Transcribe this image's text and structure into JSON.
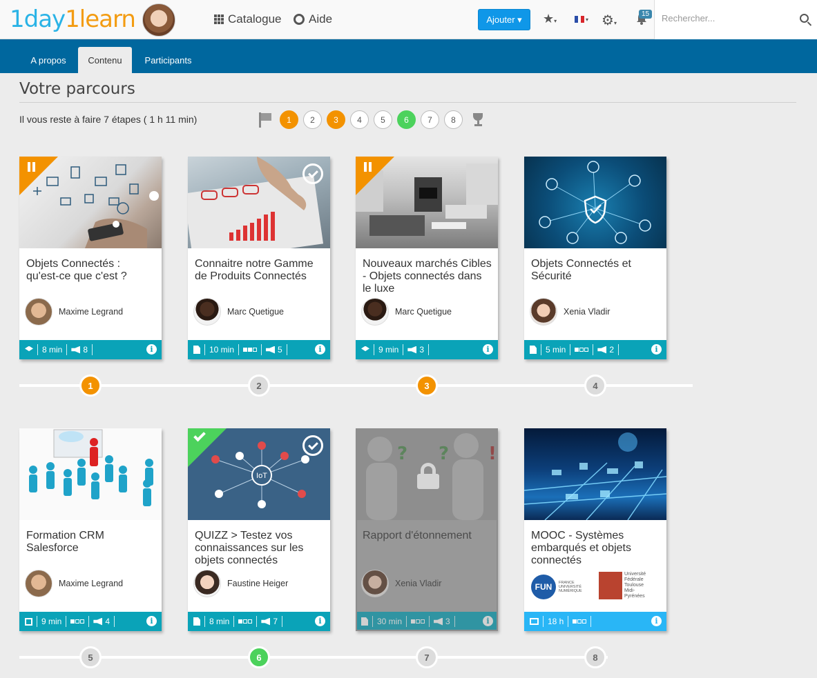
{
  "header": {
    "logo": {
      "part1": "1day",
      "part2": "1learn"
    },
    "nav": [
      {
        "label": "Catalogue",
        "icon": "grid-icon"
      },
      {
        "label": "Aide",
        "icon": "help-icon"
      }
    ],
    "add_button": "Ajouter ▾",
    "notifications_count": "15",
    "search_placeholder": "Rechercher..."
  },
  "tabs": [
    {
      "label": "A propos",
      "active": false
    },
    {
      "label": "Contenu",
      "active": true
    },
    {
      "label": "Participants",
      "active": false
    }
  ],
  "page": {
    "title": "Votre parcours",
    "remaining": "Il vous reste à faire 7 étapes ( 1 h 11 min)"
  },
  "steps": [
    {
      "label": "1",
      "state": "in-progress"
    },
    {
      "label": "2",
      "state": "todo"
    },
    {
      "label": "3",
      "state": "in-progress"
    },
    {
      "label": "4",
      "state": "todo"
    },
    {
      "label": "5",
      "state": "todo"
    },
    {
      "label": "6",
      "state": "done"
    },
    {
      "label": "7",
      "state": "todo"
    },
    {
      "label": "8",
      "state": "todo"
    }
  ],
  "cards": [
    {
      "title": "Objets Connectés : qu'est-ce que c'est ?",
      "author": "Maxime Legrand",
      "type_icon": "graduation-cap-icon",
      "duration": "8 min",
      "level": null,
      "rating": "8",
      "status": "in-progress",
      "badge": false,
      "step": "1"
    },
    {
      "title": "Connaitre notre Gamme de Produits Connectés",
      "author": "Marc Quetigue",
      "type_icon": "pdf-icon",
      "duration": "10 min",
      "level": 2,
      "rating": "5",
      "status": "todo",
      "badge": true,
      "step": "2"
    },
    {
      "title": "Nouveaux marchés Cibles - Objets connectés dans le luxe",
      "author": "Marc Quetigue",
      "type_icon": "graduation-cap-icon",
      "duration": "9 min",
      "level": null,
      "rating": "3",
      "status": "in-progress",
      "badge": false,
      "step": "3"
    },
    {
      "title": "Objets Connectés et Sécurité",
      "author": "Xenia Vladir",
      "type_icon": "pdf-icon",
      "duration": "5 min",
      "level": 1,
      "rating": "2",
      "status": "todo",
      "badge": false,
      "step": "4"
    },
    {
      "title": "Formation CRM Salesforce",
      "author": "Maxime Legrand",
      "type_icon": "module-icon",
      "duration": "9 min",
      "level": 1,
      "rating": "4",
      "status": "todo",
      "badge": false,
      "step": "5"
    },
    {
      "title": "QUIZZ > Testez vos connaissances sur les objets connectés",
      "author": "Faustine Heiger",
      "type_icon": "quiz-icon",
      "duration": "8 min",
      "level": 1,
      "rating": "7",
      "status": "done",
      "badge": true,
      "step": "6"
    },
    {
      "title": "Rapport d'étonnement",
      "author": "Xenia Vladir",
      "type_icon": "document-icon",
      "duration": "30 min",
      "level": 1,
      "rating": "3",
      "status": "locked",
      "badge": false,
      "step": "7"
    },
    {
      "title": "MOOC - Systèmes embarqués et objets connectés",
      "author": null,
      "type_icon": "mooc-icon",
      "duration": "18 h",
      "level": 1,
      "rating": null,
      "status": "todo",
      "badge": false,
      "step": "8",
      "partners": {
        "fun_short": "FUN",
        "fun_text": "FRANCE UNIVERSITÉ NUMÉRIQUE",
        "univ_text": "Université Fédérale Toulouse Midi-Pyrénées"
      }
    }
  ],
  "colors": {
    "brand_blue": "#00679e",
    "accent": "#0f97e8",
    "in_progress": "#f39200",
    "done": "#4cd25c",
    "footer": "#0aa3b8"
  }
}
